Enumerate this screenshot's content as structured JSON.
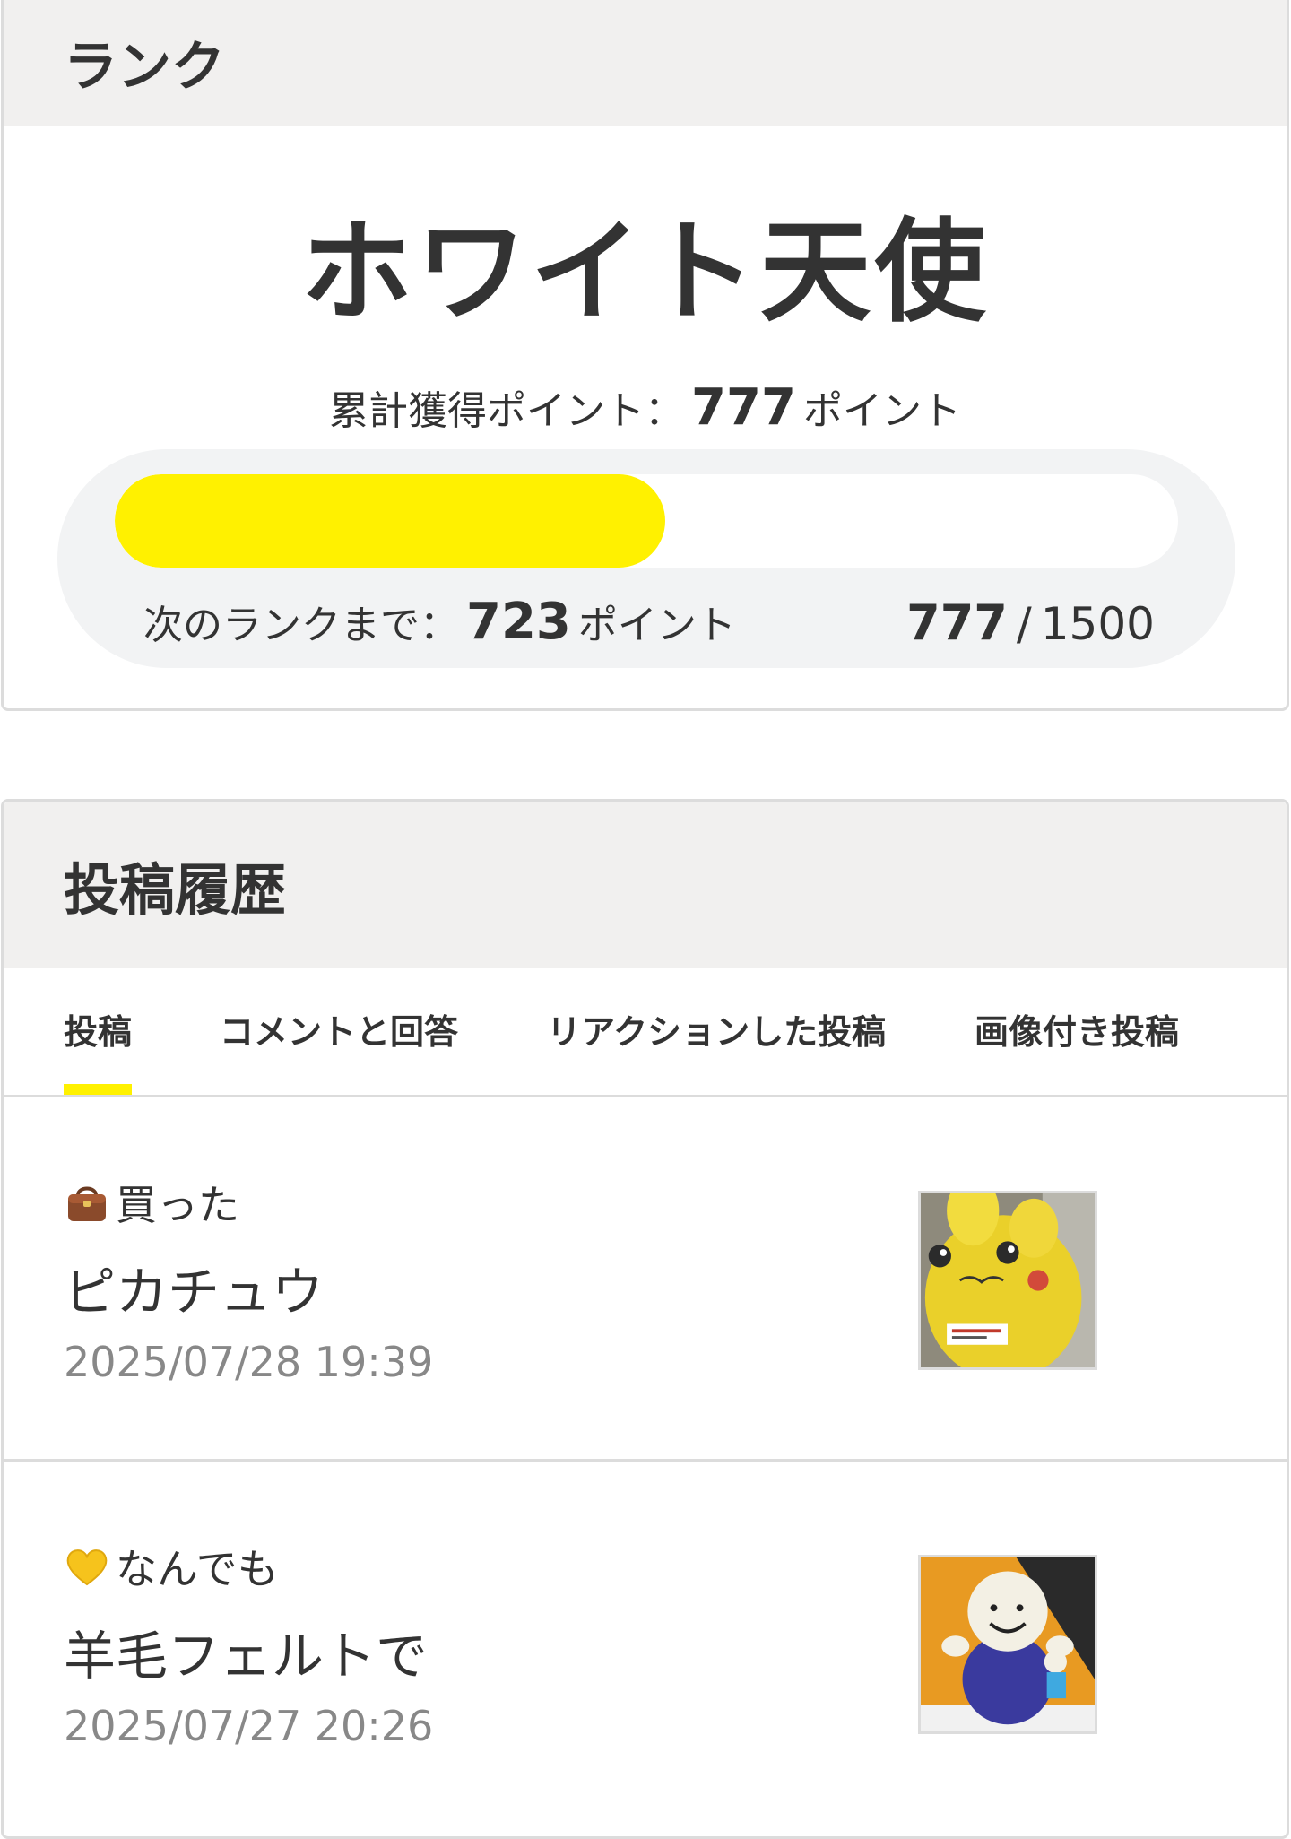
{
  "rank": {
    "heading": "ランク",
    "rank_name": "ホワイト天使",
    "total_label": "累計獲得ポイント：",
    "total_points": "777",
    "points_unit": "ポイント",
    "next_label": "次のランクまで：",
    "next_points": "723",
    "progress_current": "777",
    "progress_sep": "/",
    "progress_max": "1500",
    "progress_fraction": 0.518,
    "bar_color": "#fff100"
  },
  "posts": {
    "heading": "投稿履歴",
    "tabs": [
      {
        "label": "投稿",
        "active": true
      },
      {
        "label": "コメントと回答",
        "active": false
      },
      {
        "label": "リアクションした投稿",
        "active": false
      },
      {
        "label": "画像付き投稿",
        "active": false
      }
    ],
    "items": [
      {
        "category_icon": "handbag-icon",
        "category": "買った",
        "title": "ピカチュウ",
        "date": "2025/07/28 19:39",
        "thumbnail": "pikachu-plush-photo"
      },
      {
        "category_icon": "yellow-heart-icon",
        "category": "なんでも",
        "title": "羊毛フェルトで",
        "date": "2025/07/27 20:26",
        "thumbnail": "felt-doll-photo"
      }
    ]
  }
}
